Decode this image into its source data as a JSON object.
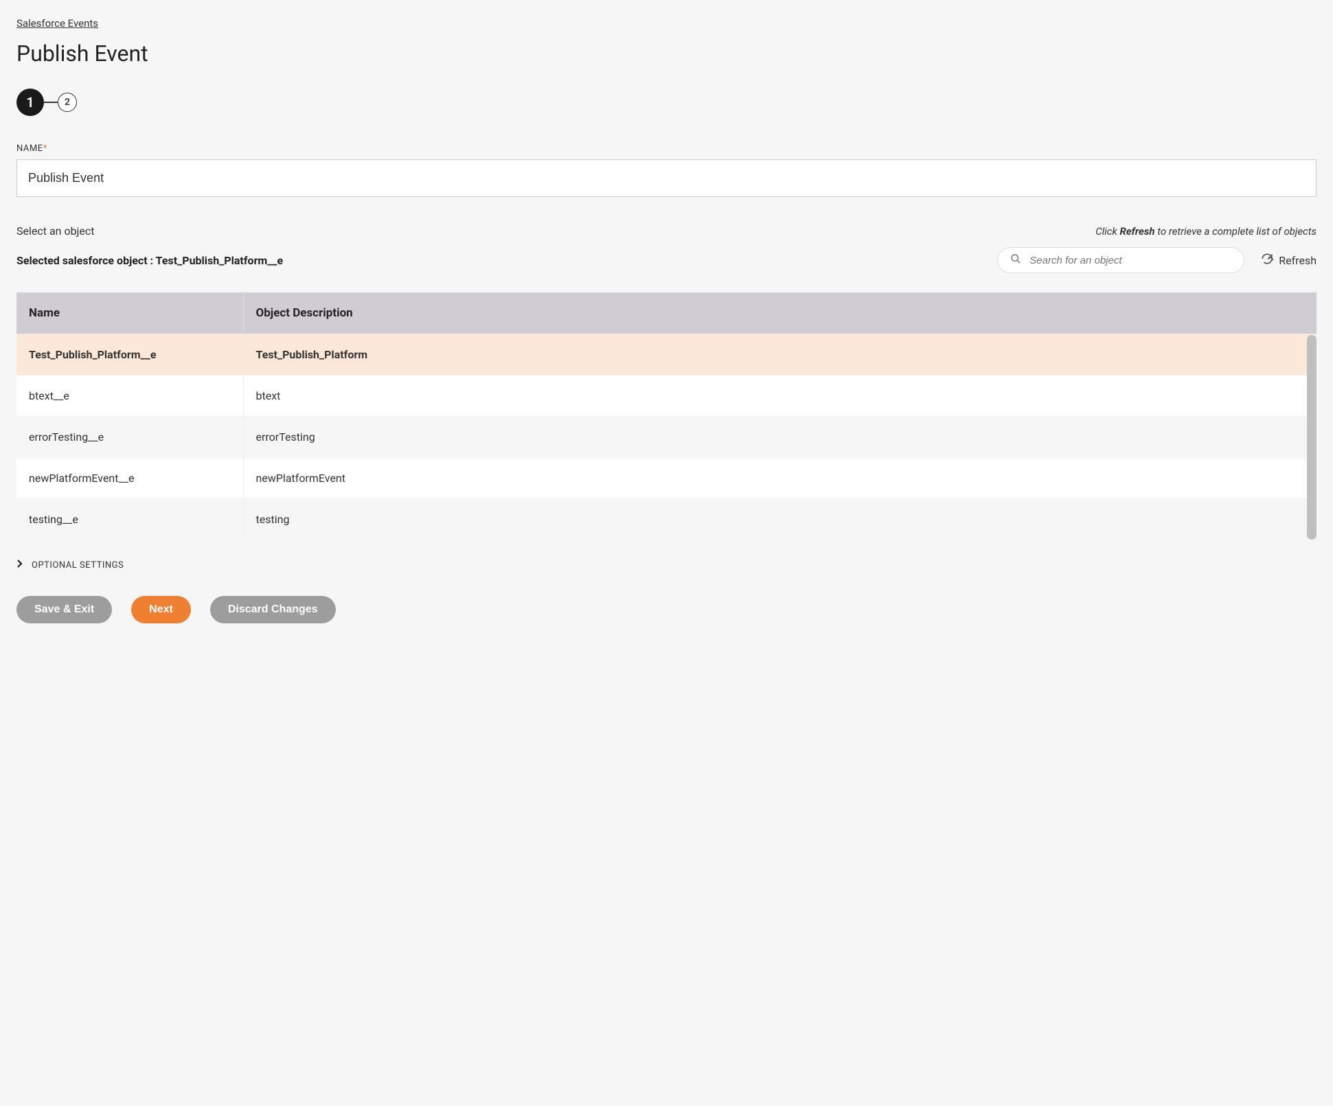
{
  "breadcrumb": "Salesforce Events",
  "page_title": "Publish Event",
  "stepper": {
    "step1": "1",
    "step2": "2"
  },
  "name_field": {
    "label": "NAME",
    "value": "Publish Event"
  },
  "select_object_label": "Select an object",
  "hint": {
    "prefix": "Click ",
    "bold": "Refresh",
    "suffix": " to retrieve a complete list of objects"
  },
  "selected_object": {
    "prefix": "Selected salesforce object : ",
    "value": "Test_Publish_Platform__e"
  },
  "search": {
    "placeholder": "Search for an object"
  },
  "refresh_label": "Refresh",
  "table": {
    "headers": {
      "name": "Name",
      "desc": "Object Description"
    },
    "rows": [
      {
        "name": "Test_Publish_Platform__e",
        "desc": "Test_Publish_Platform",
        "selected": true
      },
      {
        "name": "btext__e",
        "desc": "btext"
      },
      {
        "name": "errorTesting__e",
        "desc": "errorTesting"
      },
      {
        "name": "newPlatformEvent__e",
        "desc": "newPlatformEvent"
      },
      {
        "name": "testing__e",
        "desc": "testing"
      }
    ]
  },
  "optional_settings": "OPTIONAL SETTINGS",
  "buttons": {
    "save_exit": "Save & Exit",
    "next": "Next",
    "discard": "Discard Changes"
  }
}
